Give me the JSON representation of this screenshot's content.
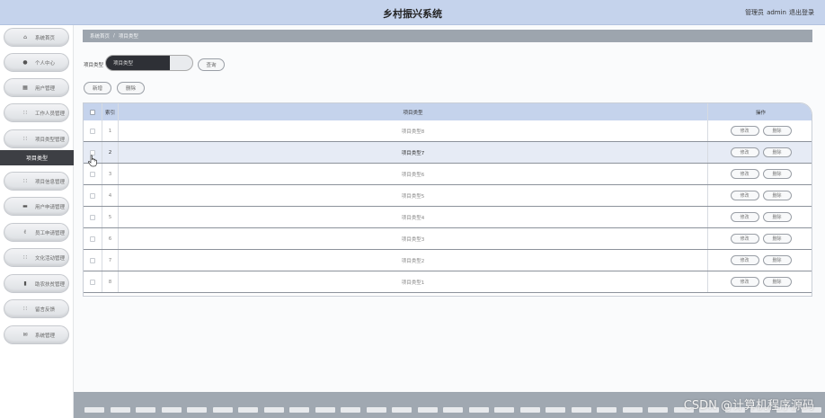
{
  "header": {
    "title": "乡村振兴系统",
    "role": "管理员",
    "username": "admin",
    "logout": "退出登录"
  },
  "sidebar": {
    "items": [
      {
        "label": "系统首页",
        "icon": "home-icon"
      },
      {
        "label": "个人中心",
        "icon": "person-icon"
      },
      {
        "label": "用户管理",
        "icon": "building-icon"
      },
      {
        "label": "工作人员管理",
        "icon": "grid-icon"
      },
      {
        "label": "项目类型管理",
        "icon": "grid-icon"
      },
      {
        "label": "项目信息管理",
        "icon": "grid-icon"
      },
      {
        "label": "用户申请管理",
        "icon": "chat-icon"
      },
      {
        "label": "员工申请管理",
        "icon": "thumbs-up-icon"
      },
      {
        "label": "文化活动管理",
        "icon": "grid-icon"
      },
      {
        "label": "助农扶贫管理",
        "icon": "bar-chart-icon"
      },
      {
        "label": "留言反馈",
        "icon": "grid-icon"
      },
      {
        "label": "系统管理",
        "icon": "envelope-icon"
      }
    ],
    "active_sub": "项目类型"
  },
  "breadcrumb": {
    "home": "系统首页",
    "separator": "/",
    "current": "项目类型"
  },
  "search": {
    "label": "项目类型",
    "value": "项目类型",
    "button": "查询"
  },
  "actions": {
    "add": "新增",
    "delete": "删除"
  },
  "table": {
    "headers": {
      "index": "索引",
      "type": "项目类型",
      "ops": "操作"
    },
    "edit_label": "修改",
    "delete_label": "删除",
    "rows": [
      {
        "index": "1",
        "type": "项目类型8"
      },
      {
        "index": "2",
        "type": "项目类型7"
      },
      {
        "index": "3",
        "type": "项目类型6"
      },
      {
        "index": "4",
        "type": "项目类型5"
      },
      {
        "index": "5",
        "type": "项目类型4"
      },
      {
        "index": "6",
        "type": "项目类型3"
      },
      {
        "index": "7",
        "type": "项目类型2"
      },
      {
        "index": "8",
        "type": "项目类型1"
      }
    ]
  },
  "watermark": "CSDN @计算机程序源码",
  "colors": {
    "header_bg": "#c5d3ec",
    "breadcrumb_bg": "#9da5ae",
    "active_sub_bg": "#3d3f44",
    "row_highlight": "#e6ebf5"
  }
}
